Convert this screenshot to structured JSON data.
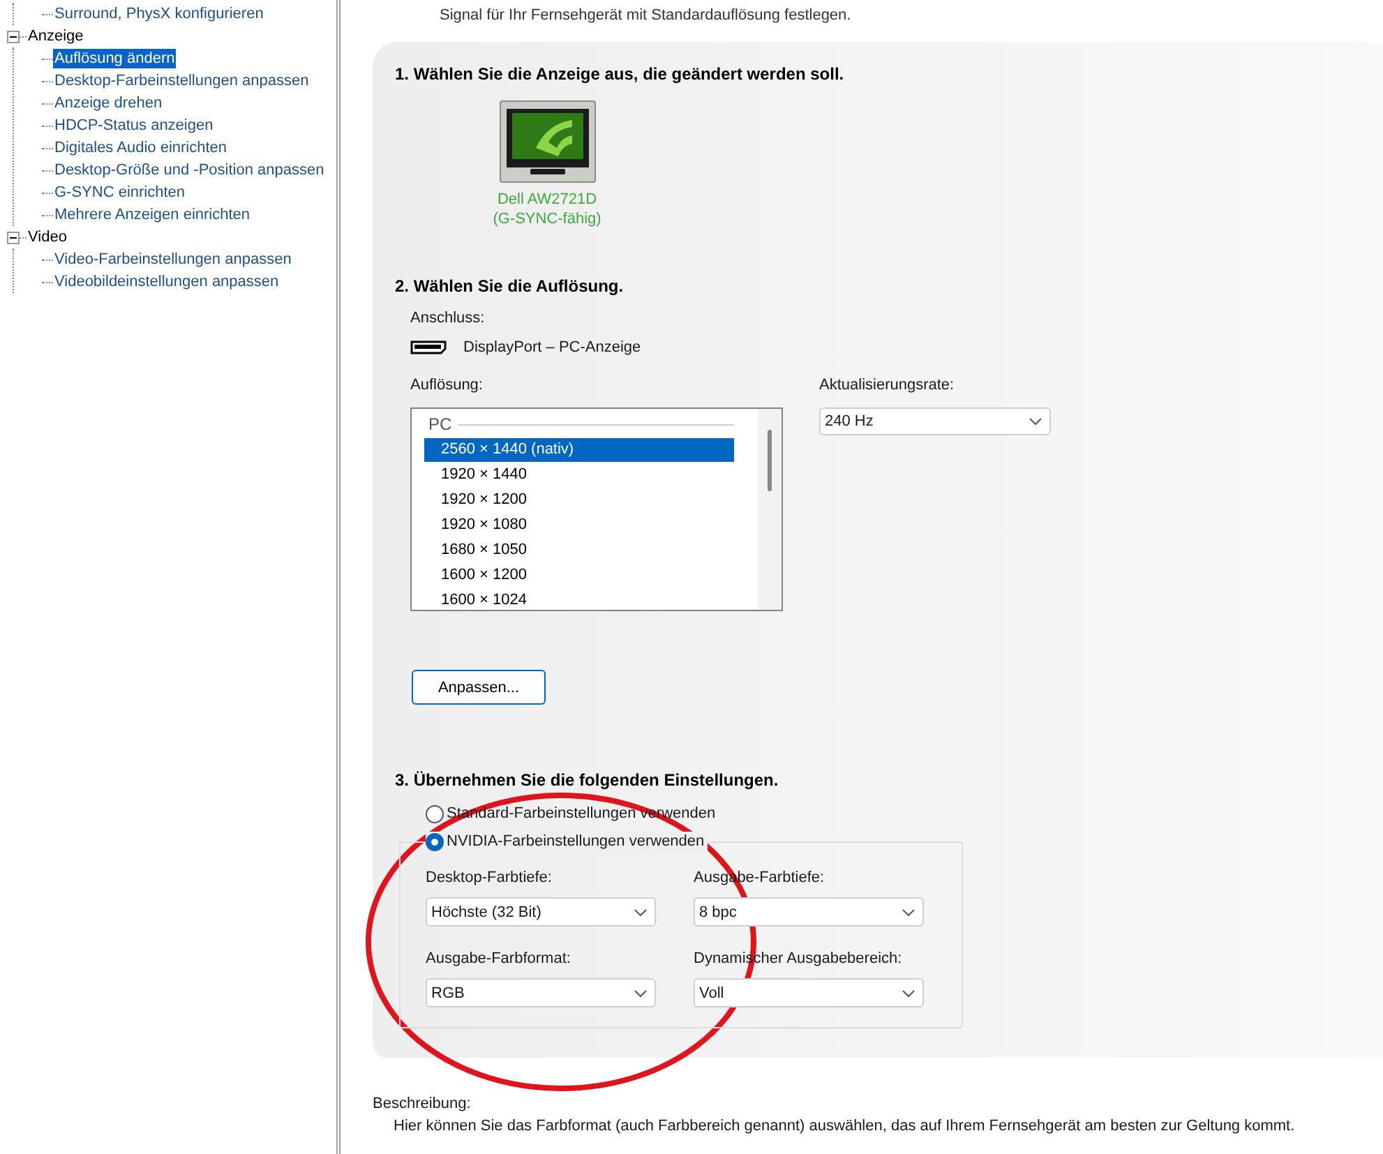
{
  "tree": [
    {
      "label": "Surround, PhysX konfigurieren",
      "selected": false
    },
    {
      "label": "Anzeige",
      "expanded": true,
      "children": [
        {
          "label": "Auflösung ändern",
          "selected": true
        },
        {
          "label": "Desktop-Farbeinstellungen anpassen",
          "selected": false
        },
        {
          "label": "Anzeige drehen",
          "selected": false
        },
        {
          "label": "HDCP-Status anzeigen",
          "selected": false
        },
        {
          "label": "Digitales Audio einrichten",
          "selected": false
        },
        {
          "label": "Desktop-Größe und -Position anpassen",
          "selected": false
        },
        {
          "label": "G-SYNC einrichten",
          "selected": false
        },
        {
          "label": "Mehrere Anzeigen einrichten",
          "selected": false
        }
      ]
    },
    {
      "label": "Video",
      "expanded": true,
      "children": [
        {
          "label": "Video-Farbeinstellungen anpassen",
          "selected": false
        },
        {
          "label": "Videobildeinstellungen anpassen",
          "selected": false
        }
      ]
    }
  ],
  "intro_text": "Signal für Ihr Fernsehgerät mit Standardauflösung festlegen.",
  "step1": {
    "title": "1. Wählen Sie die Anzeige aus, die geändert werden soll.",
    "displays": [
      {
        "name": "Dell AW2721D",
        "note": "(G-SYNC-fähig)",
        "selected": true
      }
    ]
  },
  "step2": {
    "title": "2. Wählen Sie die Auflösung.",
    "connection_label": "Anschluss:",
    "connection": "DisplayPort – PC-Anzeige",
    "resolution_label": "Auflösung:",
    "resolution_group": "PC",
    "resolutions": [
      {
        "label": "2560 × 1440 (nativ)",
        "selected": true
      },
      {
        "label": "1920 × 1440",
        "selected": false
      },
      {
        "label": "1920 × 1200",
        "selected": false
      },
      {
        "label": "1920 × 1080",
        "selected": false
      },
      {
        "label": "1680 × 1050",
        "selected": false
      },
      {
        "label": "1600 × 1200",
        "selected": false
      },
      {
        "label": "1600 × 1024",
        "selected": false
      }
    ],
    "refresh_label": "Aktualisierungsrate:",
    "refresh_rate": "240 Hz",
    "customize_button": "Anpassen..."
  },
  "step3": {
    "title": "3. Übernehmen Sie die folgenden Einstellungen.",
    "options": [
      {
        "label": "Standard-Farbeinstellungen verwenden",
        "selected": false
      },
      {
        "label": "NVIDIA-Farbeinstellungen verwenden",
        "selected": true
      }
    ],
    "fields": [
      {
        "label": "Desktop-Farbtiefe:",
        "value": "Höchste (32 Bit)"
      },
      {
        "label": "Ausgabe-Farbtiefe:",
        "value": "8 bpc"
      },
      {
        "label": "Ausgabe-Farbformat:",
        "value": "RGB"
      },
      {
        "label": "Dynamischer Ausgabebereich:",
        "value": "Voll"
      }
    ]
  },
  "description": {
    "label": "Beschreibung:",
    "text": "Hier können Sie das Farbformat (auch Farbbereich genannt) auswählen, das auf Ihrem Fernsehgerät am besten zur Geltung kommt."
  }
}
